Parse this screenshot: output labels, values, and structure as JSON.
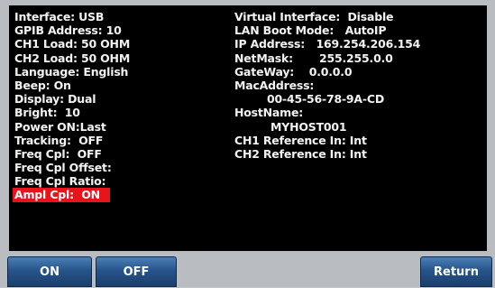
{
  "left_column": [
    {
      "label": "Interface: ",
      "value": "USB"
    },
    {
      "label": "GPIB Address: ",
      "value": "10"
    },
    {
      "label": "CH1 Load: ",
      "value": "50 OHM"
    },
    {
      "label": "CH2 Load: ",
      "value": "50 OHM"
    },
    {
      "label": "Language: ",
      "value": "English"
    },
    {
      "label": "Beep: ",
      "value": "On"
    },
    {
      "label": "Display: ",
      "value": "Dual"
    },
    {
      "label": "Bright:  ",
      "value": "10"
    },
    {
      "label": "Power ON:",
      "value": "Last"
    },
    {
      "label": "Tracking:  ",
      "value": "OFF"
    },
    {
      "label": "Freq Cpl:  ",
      "value": "OFF"
    },
    {
      "label": "Freq Cpl Offset:",
      "value": ""
    },
    {
      "label": "Freq Cpl Ratio:",
      "value": ""
    },
    {
      "label": "Ampl Cpl:  ",
      "value": "ON"
    }
  ],
  "right_column": [
    {
      "label": "Virtual Interface:  ",
      "value": "Disable"
    },
    {
      "label": "LAN Boot Mode:   ",
      "value": "AutoIP"
    },
    {
      "label": "IP Address:   ",
      "value": "169.254.206.154"
    },
    {
      "label": "NetMask:       ",
      "value": "255.255.0.0"
    },
    {
      "label": "GateWay:    ",
      "value": "0.0.0.0"
    },
    {
      "label": "MacAddress:",
      "value": ""
    },
    {
      "label": "",
      "value": "00-45-56-78-9A-CD"
    },
    {
      "label": "HostName:",
      "value": ""
    },
    {
      "label": "",
      "value": "MYHOST001"
    },
    {
      "label": "CH1 Reference In: ",
      "value": "Int"
    },
    {
      "label": "CH2 Reference In: ",
      "value": "Int"
    }
  ],
  "highlighted_row_index": 13,
  "highlight_color": "#e8141c",
  "softkeys": {
    "on_label": "ON",
    "off_label": "OFF",
    "return_label": "Return"
  }
}
